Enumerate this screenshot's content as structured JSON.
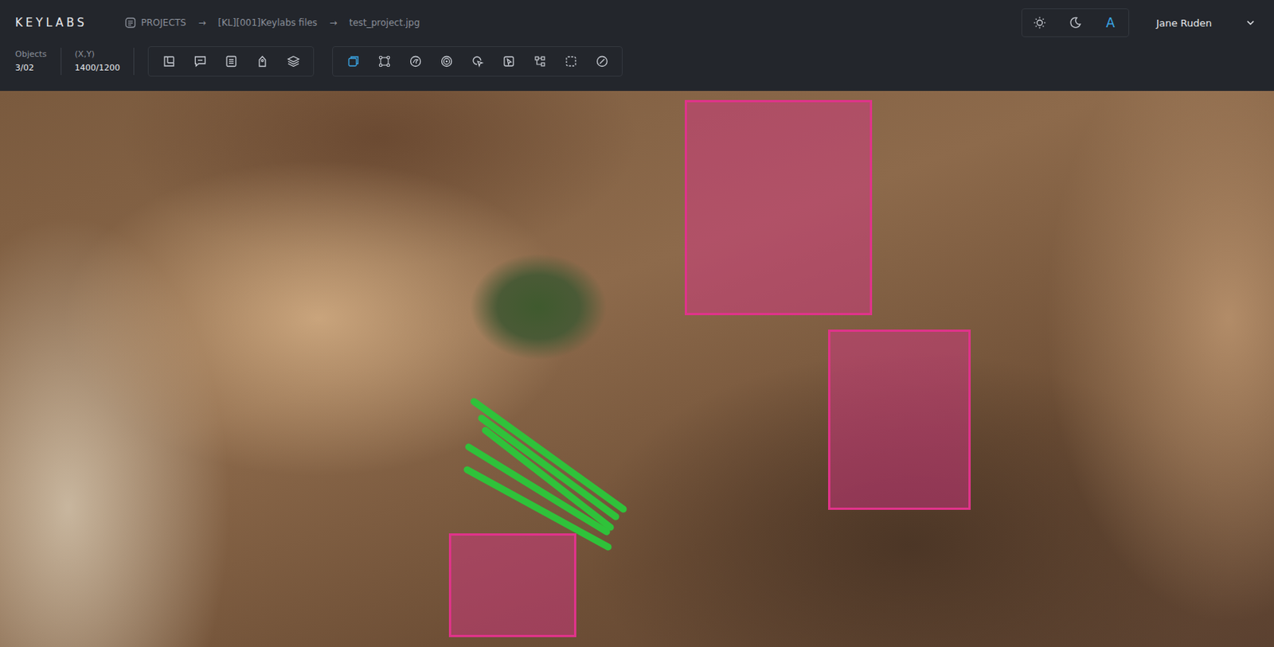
{
  "app": {
    "logo": "KEYLABS"
  },
  "breadcrumb": {
    "items": [
      "PROJECTS",
      "[KL][001]Keylabs files",
      "test_project.jpg"
    ],
    "separator": "→"
  },
  "theme": {
    "options": [
      {
        "label": "",
        "selected": false
      },
      {
        "label": "",
        "selected": false
      },
      {
        "label": "A",
        "selected": true
      }
    ]
  },
  "user": {
    "name": "Jane Ruden"
  },
  "stats": [
    {
      "label": "Objects",
      "value": "3/02"
    },
    {
      "label": "(X,Y)",
      "value": "1400/1200"
    }
  ],
  "toolbar": {
    "groups": [
      {
        "tools": [
          {
            "selected": false
          },
          {
            "selected": false
          },
          {
            "selected": false
          },
          {
            "selected": false
          },
          {
            "selected": false
          }
        ]
      },
      {
        "tools": [
          {
            "selected": true
          },
          {
            "selected": false
          },
          {
            "selected": false
          },
          {
            "selected": false
          },
          {
            "selected": false
          },
          {
            "selected": false
          },
          {
            "selected": false
          },
          {
            "selected": false
          },
          {
            "selected": false
          }
        ]
      }
    ]
  },
  "annotations": [
    {
      "kind": "box",
      "color": "#e0338a"
    },
    {
      "kind": "box",
      "color": "#e0338a"
    },
    {
      "kind": "box",
      "color": "#e0338a"
    },
    {
      "kind": "polyline",
      "color": "#2fc23a"
    }
  ]
}
